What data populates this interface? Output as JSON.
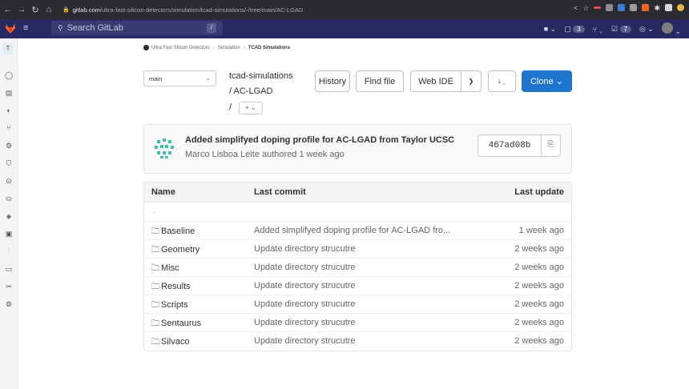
{
  "browser": {
    "url_host": "gitlab.com",
    "url_path": "/ultra-fast-silicon-detectors/simulation/tcad-simulations/-/tree/main/AC-LGAD"
  },
  "topbar": {
    "search_placeholder": "Search GitLab",
    "search_shortcut": "/",
    "issues_count": "3",
    "todos_count": "7"
  },
  "sidebar": {
    "project_letter": "T"
  },
  "breadcrumb": {
    "items": [
      "Ultra Fast Silicon Detectors",
      "Simulation",
      "TCAD Simulations"
    ]
  },
  "repo": {
    "branch": "main",
    "path_root": "tcad-simulations",
    "path_sub": "/ AC-LGAD",
    "path_sep": "/",
    "add_label": "+ ⌄",
    "history": "History",
    "find_file": "Find file",
    "web_ide": "Web IDE",
    "clone": "Clone ⌄"
  },
  "commit": {
    "title": "Added simplifyed doping profile for AC-LGAD from Taylor UCSC",
    "meta": "Marco Lisboa Leite authored 1 week ago",
    "sha": "467ad08b"
  },
  "table": {
    "headers": {
      "name": "Name",
      "last_commit": "Last commit",
      "last_update": "Last update"
    },
    "updir": "..",
    "rows": [
      {
        "name": "Baseline",
        "commit": "Added simplifyed doping profile for AC-LGAD fro...",
        "date": "1 week ago"
      },
      {
        "name": "Geometry",
        "commit": "Update directory strucutre",
        "date": "2 weeks ago"
      },
      {
        "name": "Misc",
        "commit": "Update directory strucutre",
        "date": "2 weeks ago"
      },
      {
        "name": "Results",
        "commit": "Update directory strucutre",
        "date": "2 weeks ago"
      },
      {
        "name": "Scripts",
        "commit": "Update directory strucutre",
        "date": "2 weeks ago"
      },
      {
        "name": "Sentaurus",
        "commit": "Update directory strucutre",
        "date": "2 weeks ago"
      },
      {
        "name": "Silvaco",
        "commit": "Update directory strucutre",
        "date": "2 weeks ago"
      }
    ]
  },
  "colors": {
    "topbar": "#292961",
    "clone_button": "#1f75cb"
  }
}
